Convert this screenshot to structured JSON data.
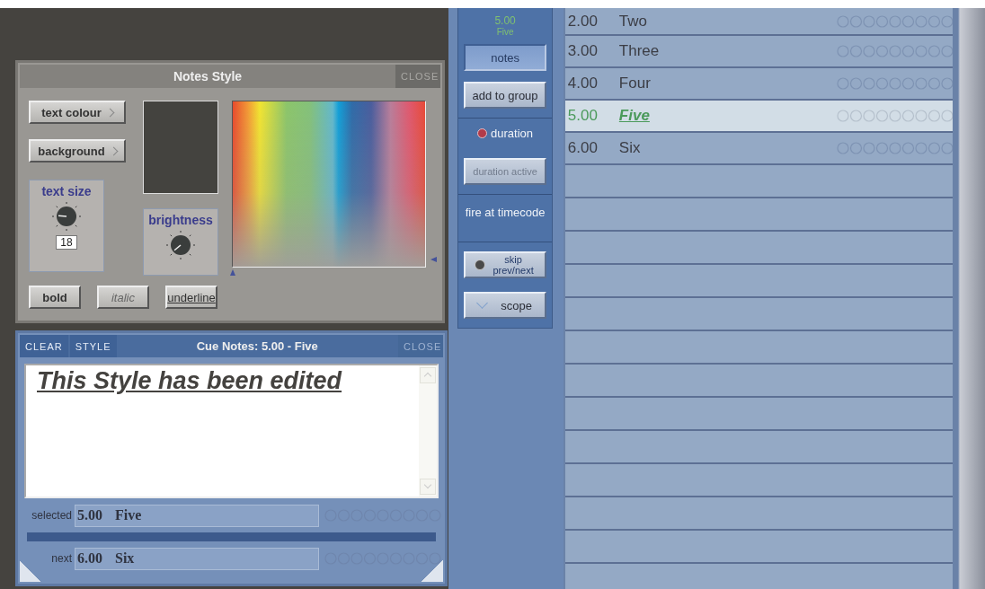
{
  "notes_style": {
    "title": "Notes Style",
    "close": "CLOSE",
    "colour_buttons": [
      "text colour",
      "background"
    ],
    "text_size": {
      "label": "text size",
      "value": "18"
    },
    "brightness": {
      "label": "brightness"
    },
    "style_buttons": [
      {
        "label": "bold",
        "kind": "bold"
      },
      {
        "label": "italic",
        "kind": "italic"
      },
      {
        "label": "underline",
        "kind": "underline"
      }
    ]
  },
  "cue_notes": {
    "buttons": [
      "CLEAR",
      "STYLE"
    ],
    "title": "Cue Notes: 5.00 - Five",
    "close": "CLOSE",
    "text": "This Style has been edited",
    "cues": [
      {
        "label": "selected",
        "number": "5.00",
        "name": "Five"
      },
      {
        "label": "next",
        "number": "6.00",
        "name": "Six"
      }
    ]
  },
  "side_panel": {
    "current_number": "5.00",
    "current_name": "Five",
    "buttons": [
      {
        "label": "notes",
        "selected": true
      },
      {
        "label": "add to group",
        "selected": false
      }
    ],
    "duration_label": "duration",
    "duration_button": {
      "label": "duration active",
      "disabled": true
    },
    "fire_label": "fire at timecode",
    "skip_button": "skip prev/next",
    "scope_button": "scope"
  },
  "cue_list": [
    {
      "number": "2.00",
      "name": "Two",
      "selected": false
    },
    {
      "number": "3.00",
      "name": "Three",
      "selected": false
    },
    {
      "number": "4.00",
      "name": "Four",
      "selected": false
    },
    {
      "number": "5.00",
      "name": "Five",
      "selected": true
    },
    {
      "number": "6.00",
      "name": "Six",
      "selected": false
    }
  ]
}
